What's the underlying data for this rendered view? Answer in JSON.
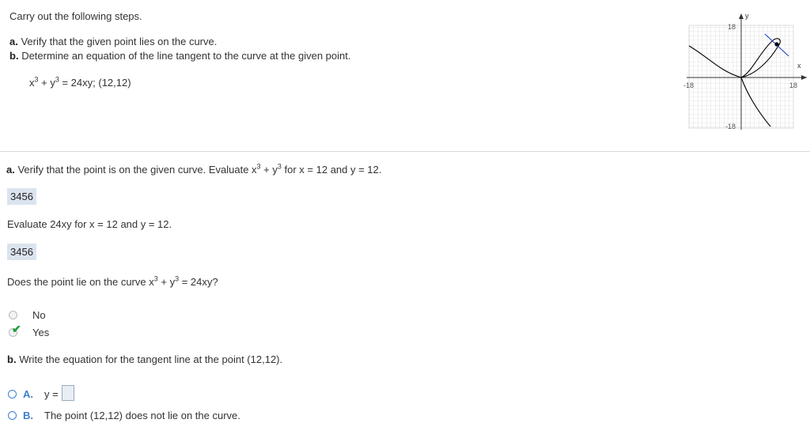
{
  "intro": "Carry out the following steps.",
  "steps": {
    "a_letter": "a.",
    "a_text": "Verify that the given point lies on the curve.",
    "b_letter": "b.",
    "b_text": "Determine an equation of the line tangent to the curve at the given point."
  },
  "equation": {
    "x": "x",
    "exp1": "3",
    "plus_y": " + y",
    "exp2": "3",
    "rest": " = 24xy; (12,12)"
  },
  "graph": {
    "y_label": "y",
    "x_label": "x",
    "top_tick": "18",
    "bottom_tick": "-18",
    "left_tick": "-18",
    "right_tick": "18",
    "curve_color": "#000000",
    "tangent_color": "#1f3fd0"
  },
  "part_a": {
    "letter": "a.",
    "text1": "Verify that the point is on the given curve. Evaluate x",
    "exp1": "3",
    "text2": " + y",
    "exp2": "3",
    "text3": " for x = 12 and y = 12.",
    "answer1": "3456",
    "eval2": "Evaluate 24xy for x = 12 and y = 12.",
    "answer2": "3456",
    "question1": "Does the point lie on the curve x",
    "qexp1": "3",
    "question2": " + y",
    "qexp2": "3",
    "question3": " = 24xy?",
    "options": [
      "No",
      "Yes"
    ],
    "selected": "Yes"
  },
  "part_b": {
    "letter": "b.",
    "text": "Write the equation for the tangent line at the point (12,12).",
    "option_a_letter": "A.",
    "option_a_text": "y =",
    "option_b_letter": "B.",
    "option_b_text": "The point (12,12) does not lie on the curve."
  }
}
